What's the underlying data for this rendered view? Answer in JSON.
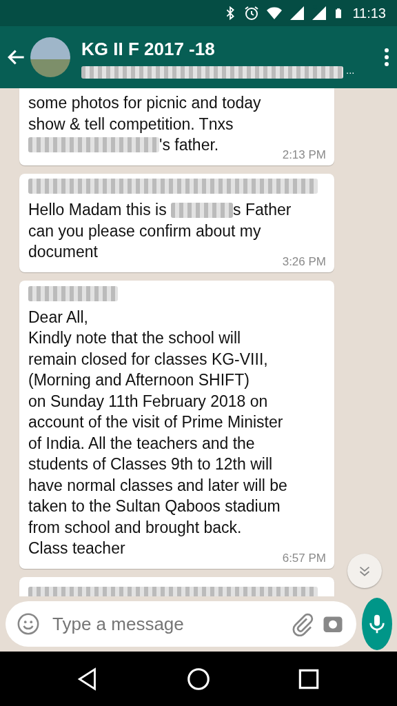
{
  "status_bar": {
    "time": "11:13"
  },
  "header": {
    "title": "KG II  F 2017 -18",
    "subtitle_hidden": true,
    "subtitle_suffix": "..."
  },
  "messages": [
    {
      "sender_hidden": false,
      "lines": [
        [
          {
            "kind": "text",
            "text": "some photos for picnic and today"
          }
        ],
        [
          {
            "kind": "text",
            "text": "show & tell competition. Tnxs"
          }
        ],
        [
          {
            "kind": "redacted"
          },
          {
            "kind": "text",
            "text": "'s father."
          }
        ]
      ],
      "time": "2:13 PM"
    },
    {
      "sender_hidden": true,
      "lines": [
        [
          {
            "kind": "text",
            "text": "Hello Madam this is "
          },
          {
            "kind": "redacted"
          },
          {
            "kind": "text",
            "text": "s Father"
          }
        ],
        [
          {
            "kind": "text",
            "text": "can you please confirm about my"
          }
        ],
        [
          {
            "kind": "text",
            "text": "document"
          }
        ]
      ],
      "time": "3:26 PM"
    },
    {
      "sender_hidden": true,
      "lines": [
        [
          {
            "kind": "text",
            "text": "Dear All,"
          }
        ],
        [
          {
            "kind": "text",
            "text": "Kindly note that the school will"
          }
        ],
        [
          {
            "kind": "text",
            "text": "remain closed for classes KG-VIII,"
          }
        ],
        [
          {
            "kind": "text",
            "text": "(Morning and Afternoon SHIFT)"
          }
        ],
        [
          {
            "kind": "text",
            "text": "on Sunday 11th February 2018 on"
          }
        ],
        [
          {
            "kind": "text",
            "text": "account of the visit of Prime Minister"
          }
        ],
        [
          {
            "kind": "text",
            "text": "of India. All the teachers and the"
          }
        ],
        [
          {
            "kind": "text",
            "text": "students of Classes 9th to 12th will"
          }
        ],
        [
          {
            "kind": "text",
            "text": "have normal classes and later will be"
          }
        ],
        [
          {
            "kind": "text",
            "text": "taken to the Sultan Qaboos stadium"
          }
        ],
        [
          {
            "kind": "text",
            "text": "from school and brought back."
          }
        ],
        [
          {
            "kind": "text",
            "text": "Class teacher"
          }
        ]
      ],
      "time": "6:57 PM"
    },
    {
      "sender_hidden": true
    }
  ],
  "composer": {
    "placeholder": "Type a message"
  }
}
